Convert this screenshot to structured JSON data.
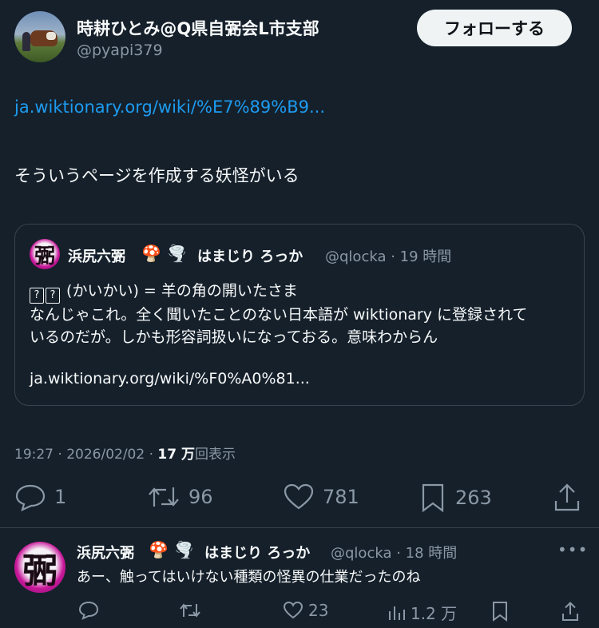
{
  "author": {
    "display_name": "時耕ひとみ@Q県自弻会L市支部",
    "handle": "@pyapi379"
  },
  "follow_button_label": "フォローする",
  "post": {
    "link": "ja.wiktionary.org/wiki/%E7%89%B9...",
    "text": "そういうページを作成する妖怪がいる"
  },
  "quote": {
    "avatar_glyph": "弻",
    "name": "浜尻六弻",
    "emoji1": "🍄",
    "emoji2": "🌪️",
    "name2": "はまじり ろっか",
    "handle_time": "@qlocka · 19 時間",
    "line1_suffix": " (かいかい) = 羊の角の開いたさま",
    "line2": "なんじゃこれ。全く聞いたことのない日本語が wiktionary に登録されて",
    "line3": "いるのだが。しかも形容詞扱いになっておる。意味わからん",
    "line5": "ja.wiktionary.org/wiki/%F0%A0%81..."
  },
  "meta": {
    "timestamp": "19:27 · 2026/02/02 · ",
    "views_count": "17 万",
    "views_label": "回表示"
  },
  "actions": {
    "replies": "1",
    "reposts": "96",
    "likes": "781",
    "bookmarks": "263"
  },
  "reply": {
    "avatar_glyph": "弻",
    "name": "浜尻六弻",
    "emoji1": "🍄",
    "emoji2": "🌪️",
    "name2": "はまじり ろっか",
    "handle_time": "@qlocka · 18 時間",
    "more": "•••",
    "text": "あー、触ってはいけない種類の怪異の仕業だったのね",
    "likes": "23",
    "views": "1.2 万"
  },
  "icons": {
    "reply": "speech-bubble-icon",
    "repost": "repost-arrows-icon",
    "like": "heart-icon",
    "bookmark": "bookmark-icon",
    "share": "share-upload-icon",
    "views": "bar-chart-icon",
    "more": "more-dots-icon"
  },
  "colors": {
    "background": "#15202b",
    "link": "#1d9bf0",
    "muted": "#8b98a5",
    "button_bg": "#eff3f4"
  }
}
